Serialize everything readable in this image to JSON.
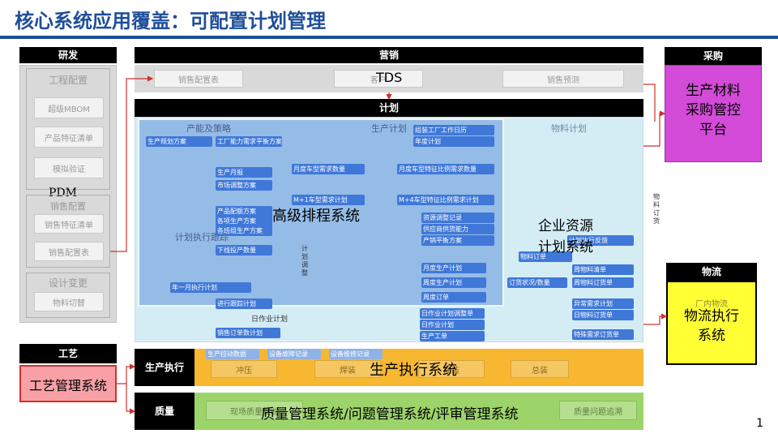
{
  "title": "核心系统应用覆盖：可配置计划管理",
  "page_number": "1",
  "sections": {
    "rnd": "研发",
    "marketing": "营销",
    "purchase": "采购",
    "plan": "计划",
    "logistics": "物流",
    "process": "工艺",
    "production": "生产执行",
    "quality": "质量"
  },
  "systems": {
    "pdm": "PDM",
    "tds": "TDS",
    "aps": "高级排程系统",
    "erp_line1": "企业资源",
    "erp_line2": "计划系统",
    "srm_line1": "生产材料",
    "srm_line2": "采购管控",
    "srm_line3": "平台",
    "les_line1": "物流执行",
    "les_line2": "系统",
    "process_sys": "工艺管理系统",
    "mes": "生产执行系统",
    "qms": "质量管理系统/问题管理系统/评审管理系统"
  },
  "rnd_items": {
    "engineering": "工程配置",
    "mbom": "超级MBOM",
    "features": "产品特征清单",
    "validation": "模拟验证",
    "sales_config": "销售配置",
    "feature_list": "销售特征清单",
    "config_table": "销售配置表",
    "design_change": "设计变更",
    "material_switch": "物料切替"
  },
  "marketing_items": {
    "config_table": "销售配置表",
    "customer": "客户",
    "forecast": "销售预测"
  },
  "plan_columns": {
    "strategy": "产能及策略",
    "production": "生产计划",
    "material": "物料计划",
    "execution": "计划执行跟踪",
    "adjust": "计划调整",
    "daily": "日作业计划"
  },
  "plan_chips": [
    "生产规划方案",
    "工厂能力需求平衡方案",
    "生产月报",
    "市场调整方案",
    "产品配额方案",
    "各项生产方案",
    "各班组生产方案",
    "下线投产数量",
    "年一月执行计划",
    "进行跟踪计划",
    "销售订单数计划",
    "月度车型需求数量",
    "M+1车型需求计划",
    "组装工厂工作日历",
    "年度计划",
    "月度车型特征比例需求数量",
    "M+4车型特征比例需求计划",
    "资源调整记录",
    "供应商供货能力",
    "产销平衡方案",
    "月度生产计划",
    "周度生产计划",
    "周度订单",
    "日作业计划调整单",
    "日作业计划",
    "生产工单",
    "计划执行反馈",
    "物料订单",
    "周物料清单",
    "订货状况/数量",
    "周物料订货单",
    "异常需求计划",
    "日物料订货单",
    "特殊需求订货单"
  ],
  "plan_labels": {
    "vertical_adjust": "计划调整",
    "material_order": "物料订货"
  },
  "production_items": {
    "press": "冲压",
    "weld": "焊装",
    "paint": "涂装",
    "assembly": "总装",
    "chips": [
      "生产拉动数据",
      "设备故障记录",
      "设备维修记录"
    ]
  },
  "quality_items": {
    "left": "现场质量检验",
    "right": "质量问题追溯"
  },
  "logistics_items": {
    "inner": "厂内物流"
  },
  "colors": {
    "title_blue": "#1f4e9a",
    "aps_blue": "#6f9fe0",
    "erp_cyan": "#bfe8f2",
    "srm_magenta": "#d34bd8",
    "lem_yellow": "#ffff33",
    "mes_orange": "#f7b731",
    "qms_green": "#9dd46a",
    "process_pink": "#f7a1a7",
    "arrow_red": "#d0312d"
  }
}
